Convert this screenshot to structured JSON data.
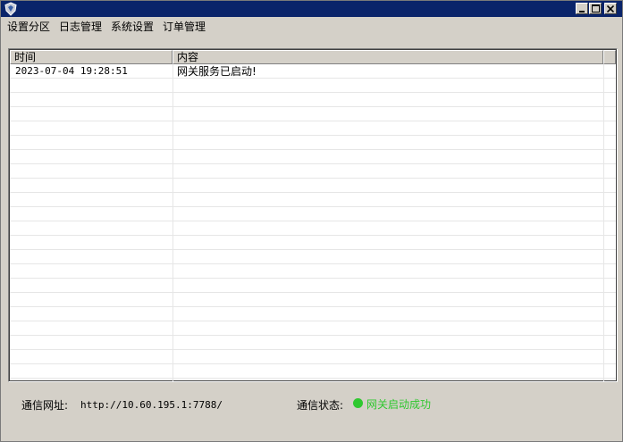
{
  "window": {
    "app_icon": "shield-app-icon",
    "controls": {
      "minimize": "minimize-icon",
      "maximize": "maximize-icon",
      "close": "close-icon"
    }
  },
  "menu": [
    {
      "label": "设置分区"
    },
    {
      "label": "日志管理"
    },
    {
      "label": "系统设置"
    },
    {
      "label": "订单管理"
    }
  ],
  "log_table": {
    "columns": {
      "time": "时间",
      "content": "内容"
    },
    "rows": [
      {
        "time": "2023-07-04 19:28:51",
        "content": "网关服务已启动!"
      }
    ]
  },
  "status": {
    "address_label": "通信网址:",
    "address_value": "http://10.60.195.1:7788/",
    "state_label": "通信状态:",
    "state_value": "网关启动成功",
    "state_color": "#2fc82f"
  }
}
